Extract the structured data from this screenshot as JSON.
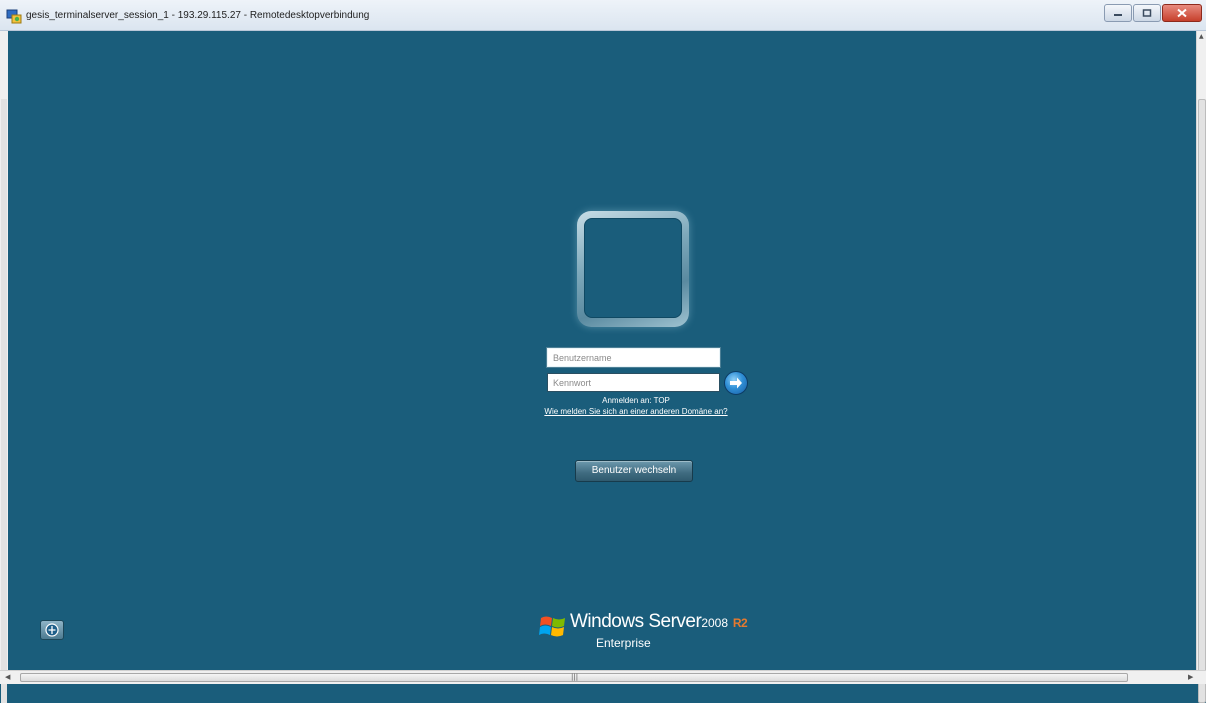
{
  "window": {
    "title": "gesis_terminalserver_session_1 - 193.29.115.27 - Remotedesktopverbindung"
  },
  "login": {
    "username_placeholder": "Benutzername",
    "password_placeholder": "Kennwort",
    "logon_to": "Anmelden an: TOP",
    "other_domain_link": "Wie melden Sie sich an einer anderen Domäne an?",
    "switch_user_label": "Benutzer wechseln"
  },
  "branding": {
    "product": "Windows Server",
    "version": "2008",
    "release": "R2",
    "edition": "Enterprise"
  },
  "colors": {
    "background": "#1a5d7b",
    "accent_r2": "#e57a2f"
  },
  "icons": [
    "rdp-app-icon",
    "minimize-icon",
    "maximize-icon",
    "close-icon",
    "user-tile-icon",
    "arrow-right-icon",
    "ease-of-access-icon",
    "windows-flag-icon"
  ]
}
